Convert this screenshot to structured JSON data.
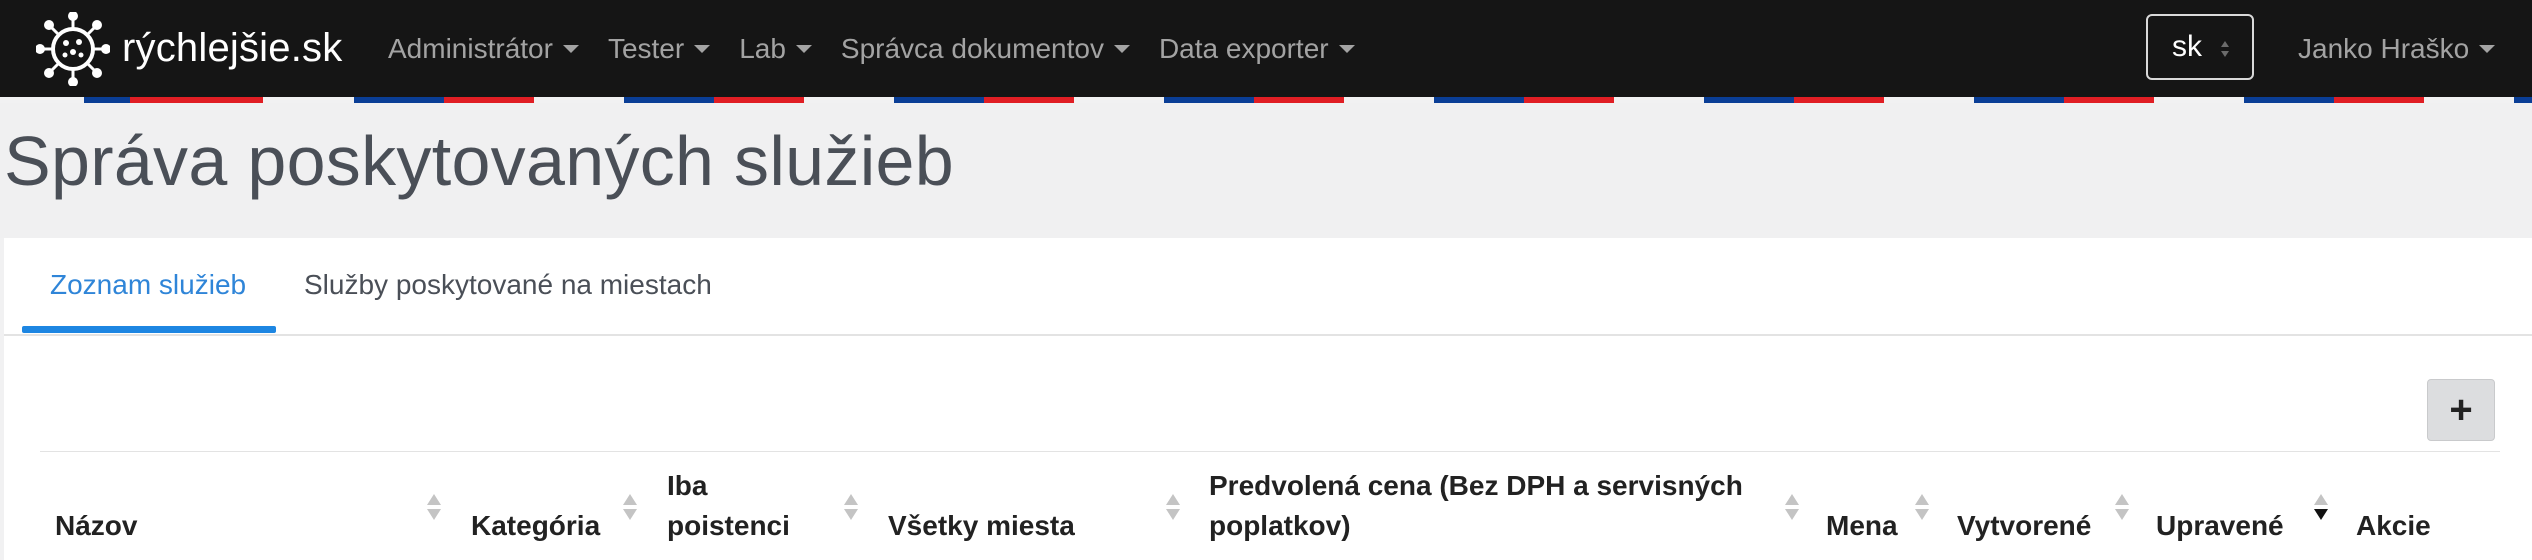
{
  "navbar": {
    "brand": "rýchlejšie.sk",
    "menu": [
      {
        "label": "Administrátor"
      },
      {
        "label": "Tester"
      },
      {
        "label": "Lab"
      },
      {
        "label": "Správca dokumentov"
      },
      {
        "label": "Data exporter"
      }
    ],
    "language": "sk",
    "user": "Janko Hraško"
  },
  "page": {
    "title": "Správa poskytovaných služieb"
  },
  "tabs": [
    {
      "label": "Zoznam služieb",
      "active": true
    },
    {
      "label": "Služby poskytované na miestach",
      "active": false
    }
  ],
  "toolbar": {
    "add_label": "+"
  },
  "table": {
    "columns": [
      {
        "line1": "",
        "line2": "Názov",
        "sort": "none"
      },
      {
        "line1": "",
        "line2": "Kategória",
        "sort": "none"
      },
      {
        "line1": "Iba",
        "line2": "poistenci",
        "sort": "none"
      },
      {
        "line1": "",
        "line2": "Všetky miesta",
        "sort": "none"
      },
      {
        "line1": "Predvolená cena (Bez DPH a servisných",
        "line2": "poplatkov)",
        "sort": "none"
      },
      {
        "line1": "",
        "line2": "Mena",
        "sort": "none"
      },
      {
        "line1": "",
        "line2": "Vytvorené",
        "sort": "none"
      },
      {
        "line1": "",
        "line2": "Upravené",
        "sort": "descending"
      },
      {
        "line1": "",
        "line2": "Akcie",
        "sort": null
      }
    ]
  },
  "colors": {
    "navbar_bg": "#151515",
    "accent": "#1d86e2",
    "flag_blue": "#0a3e96",
    "flag_red": "#e01e24"
  }
}
